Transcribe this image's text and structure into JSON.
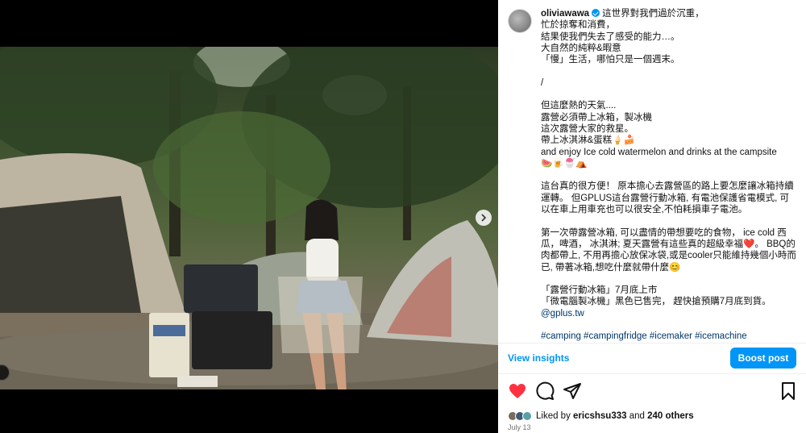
{
  "post": {
    "username": "oliviawawa",
    "caption_lines": [
      "這世界對我們過於沉重，",
      "忙於掠奪和消費，",
      "結果使我們失去了感受的能力…。",
      "大自然的純粹&暇意",
      "「慢」生活，哪怕只是一個週末。",
      "",
      "/",
      "",
      "但這麼熱的天氣....",
      "露營必須帶上冰箱，製冰機",
      "這次露營大家的救星。",
      "帶上冰淇淋&蛋糕🍦🍰",
      "and enjoy Ice cold watermelon and drinks at the campsite",
      "🍉🍺🍧⛺",
      "",
      "這台真的很方便！ 原本擔心去露營區的路上要怎麼讓冰箱持續運轉。 但GPLUS這台露營行動冰箱, 有電池保護省電模式, 可以在車上用車充也可以很安全,不怕耗損車子電池。",
      "",
      "第一次帶露營冰箱, 可以盡情的帶想要吃的食物， ice cold 西瓜，啤酒， 冰淇淋; 夏天露營有這些真的超級幸福❤️。 BBQ的肉都帶上, 不用再擔心放保冰袋,或是cooler只能維持幾個小時而已, 帶著冰箱,想吃什麼就帶什麼😊",
      "",
      "「露營行動冰箱」7月底上市",
      "「微電腦製冰機」黑色已售完， 趕快搶預購7月底到貨。"
    ],
    "mention": "@gplus.tw",
    "hashtags": "#camping #campingfridge #icemaker #icemachine",
    "view_insights": "View insights",
    "boost_label": "Boost post",
    "likes_prefix": "Liked by ",
    "likes_user": "ericshsu333",
    "likes_and": " and ",
    "likes_count": "240 others",
    "date": "July 13"
  },
  "icons": {
    "like": "heart-filled-icon",
    "comment": "comment-icon",
    "share": "paper-plane-icon",
    "save": "bookmark-icon",
    "next": "chevron-right-icon"
  },
  "colors": {
    "accent": "#0095f6",
    "like": "#ff3040",
    "link": "#00376b",
    "muted": "#737373"
  }
}
